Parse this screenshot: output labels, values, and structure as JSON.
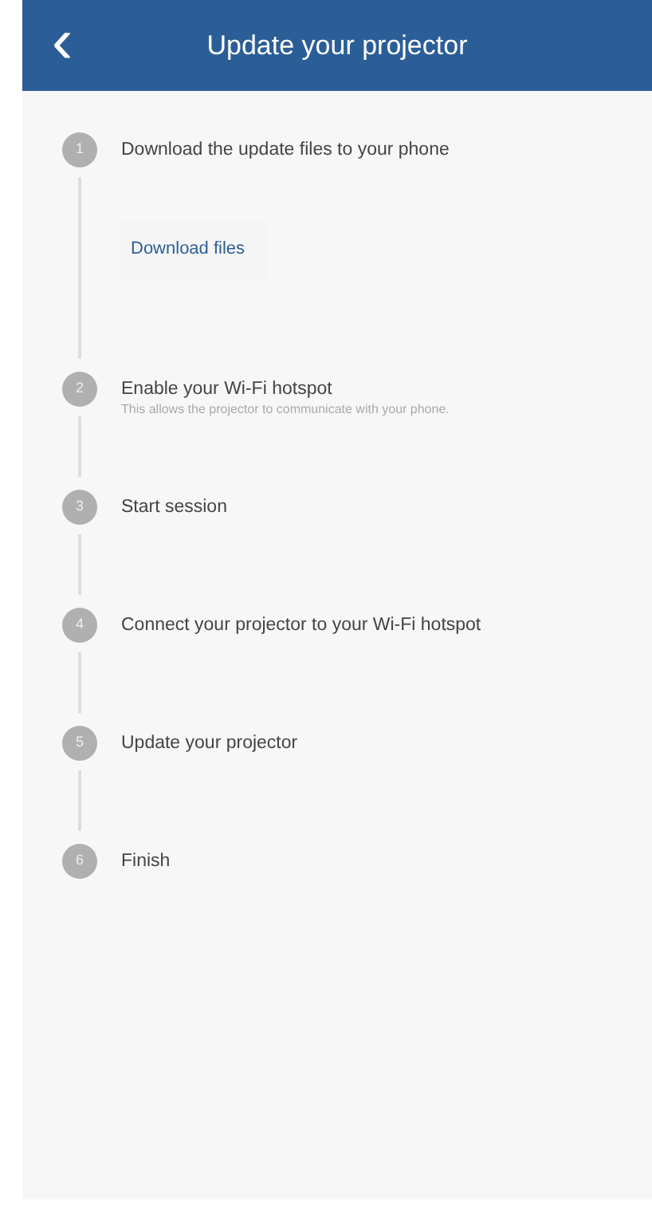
{
  "header": {
    "back": "‹",
    "title": "Update your projector"
  },
  "steps": [
    {
      "number": "1",
      "title": "Download the update files to your phone",
      "action": "Download files"
    },
    {
      "number": "2",
      "title": "Enable your Wi-Fi hotspot",
      "subtitle": "This allows the projector to communicate with your phone."
    },
    {
      "number": "3",
      "title": "Start session"
    },
    {
      "number": "4",
      "title": "Connect your projector to your Wi-Fi hotspot"
    },
    {
      "number": "5",
      "title": "Update your projector"
    },
    {
      "number": "6",
      "title": "Finish"
    }
  ]
}
